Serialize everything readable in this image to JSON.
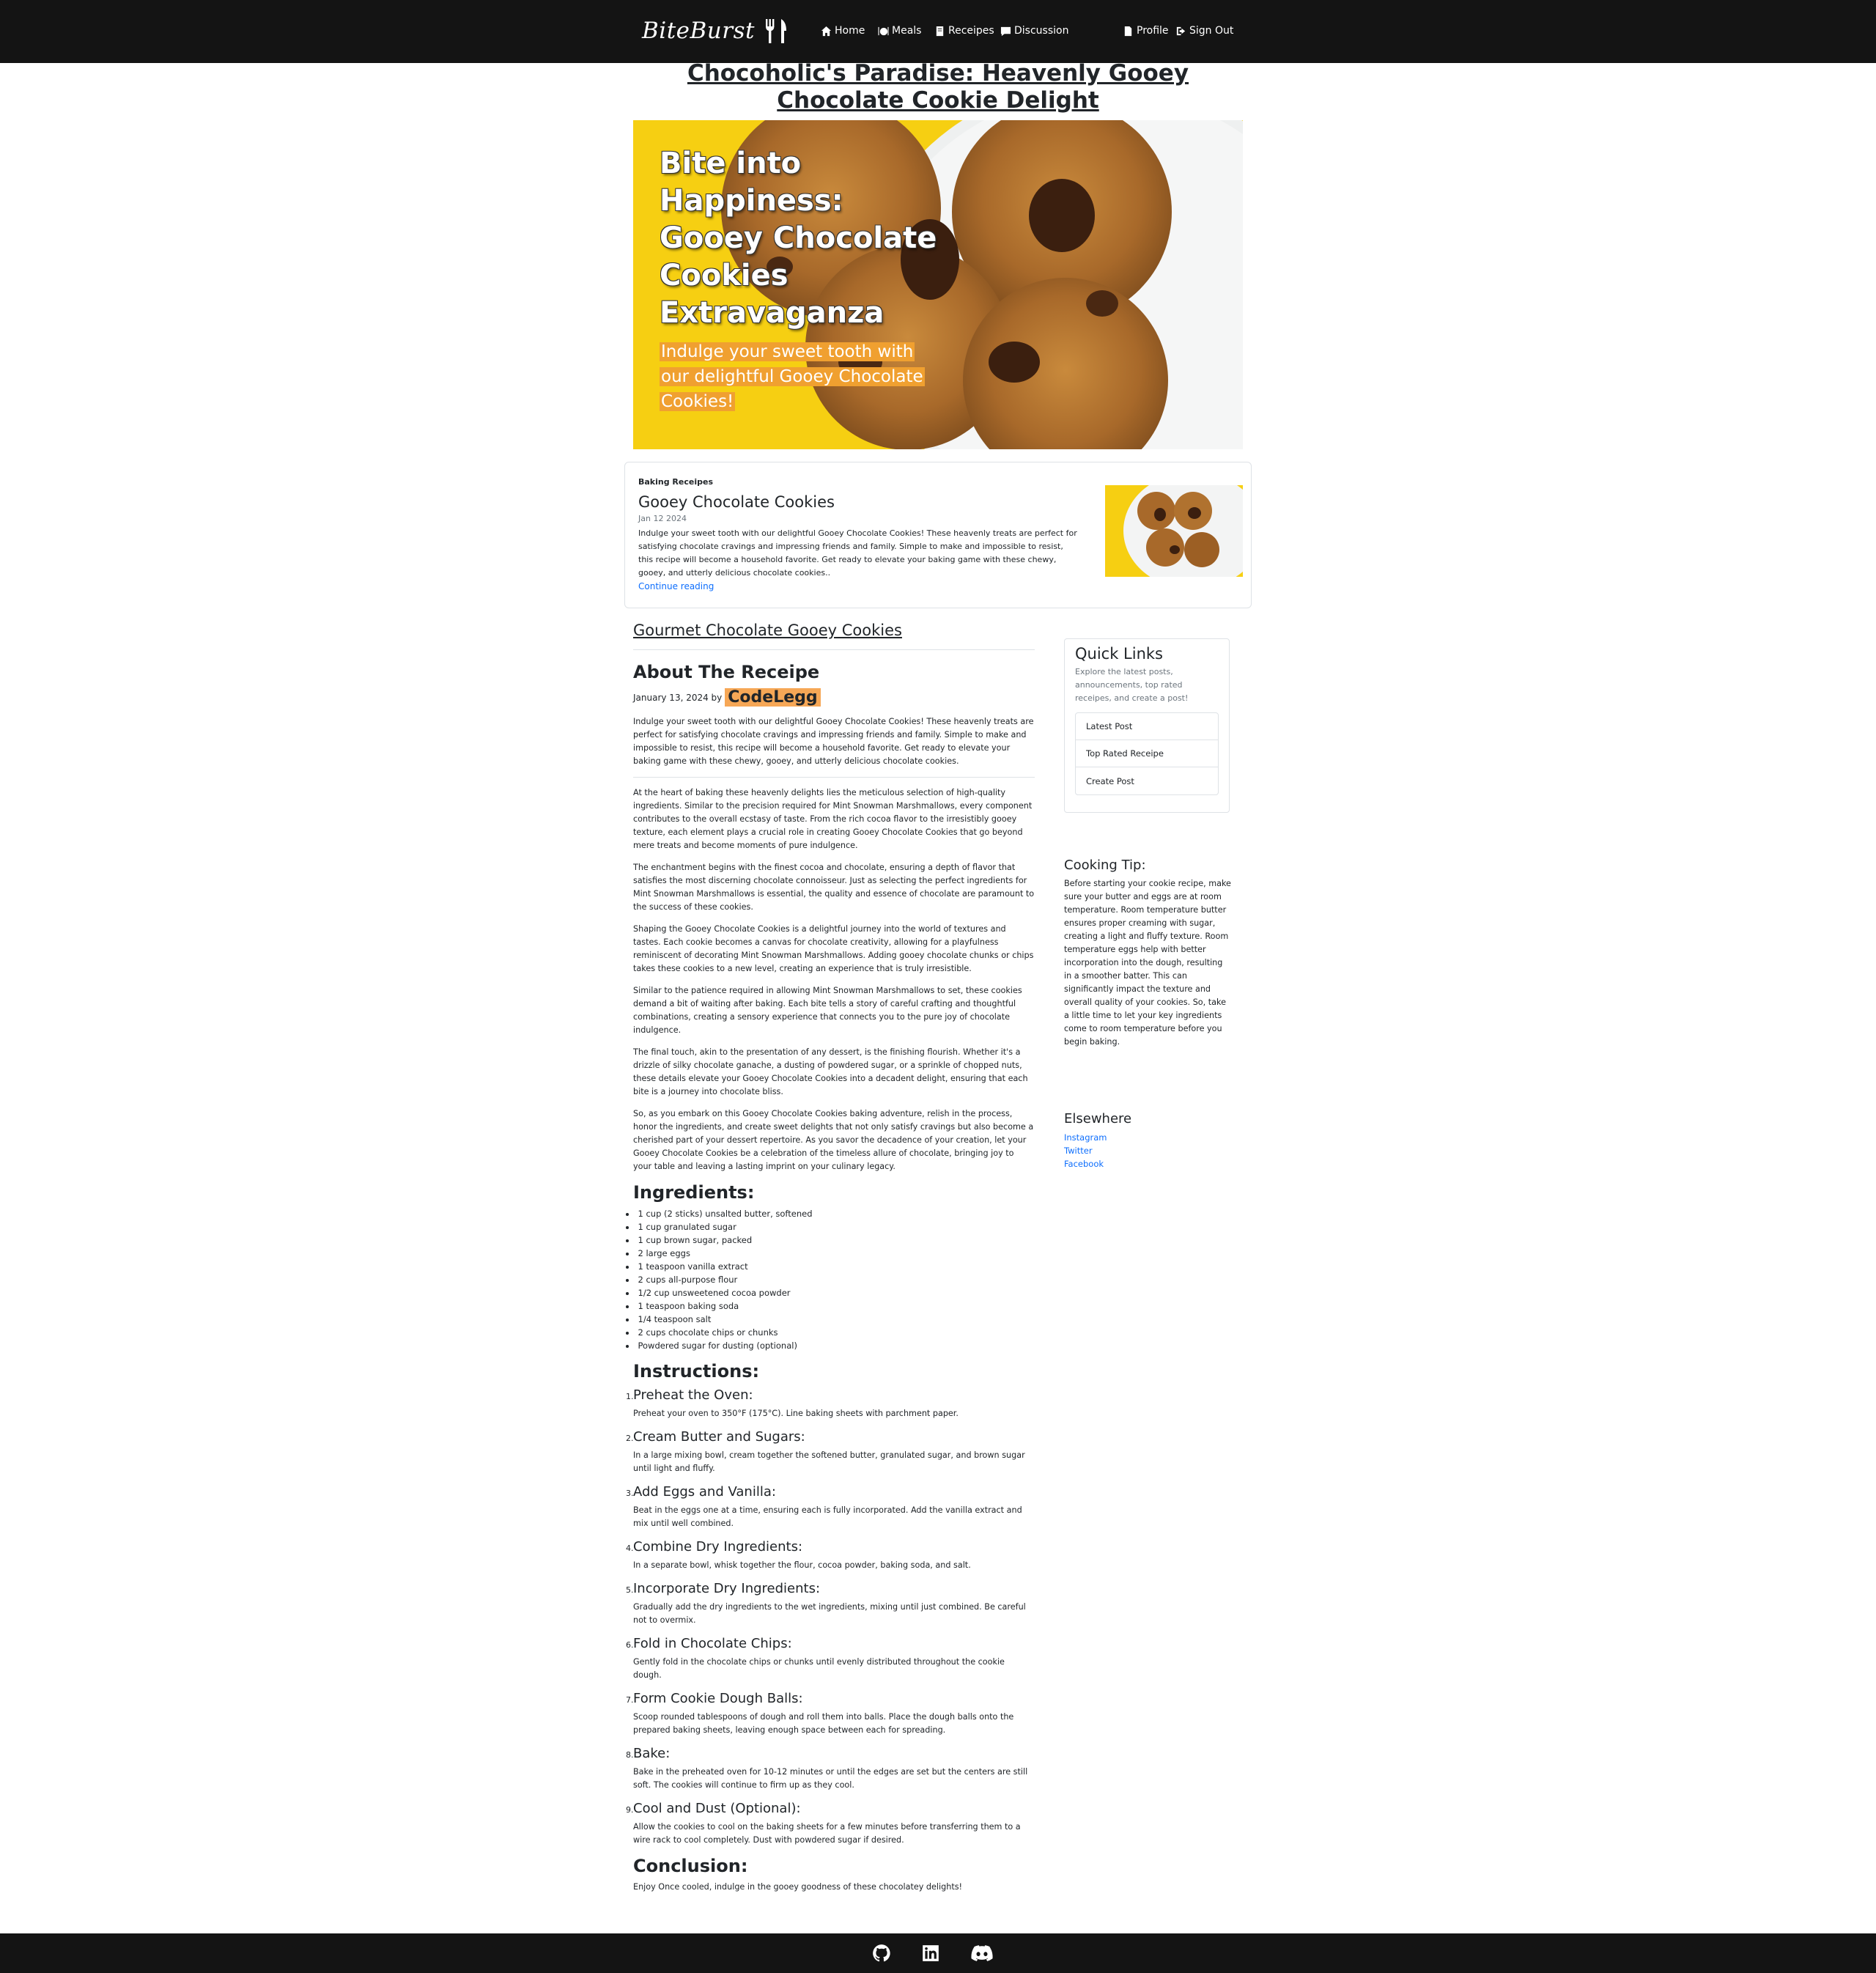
{
  "brand": {
    "name": "BiteBurst"
  },
  "nav": {
    "home": "Home",
    "meals": "Meals",
    "receipes": "Receipes",
    "discussion": "Discussion",
    "profile": "Profile",
    "signout": "Sign Out"
  },
  "page_title": "Chocoholic's Paradise: Heavenly Gooey Chocolate Cookie Delight",
  "hero": {
    "headline": "Bite into Happiness: Gooey Chocolate Cookies Extravaganza",
    "subtext": "Indulge your sweet tooth with our delightful Gooey Chocolate Cookies!"
  },
  "featured": {
    "category": "Baking Receipes",
    "title": "Gooey Chocolate Cookies",
    "date": "Jan 12 2024",
    "body": "Indulge your sweet tooth with our delightful Gooey Chocolate Cookies! These heavenly treats are perfect for satisfying chocolate cravings and impressing friends and family. Simple to make and impossible to resist, this recipe will become a household favorite. Get ready to elevate your baking game with these chewy, gooey, and utterly delicious chocolate cookies..",
    "link": "Continue reading"
  },
  "article": {
    "section_title": "Gourmet Chocolate Gooey Cookies",
    "about_title": "About The Receipe",
    "byline_date": "January 13, 2024 by",
    "author": "CodeLegg",
    "intro": "Indulge your sweet tooth with our delightful Gooey Chocolate Cookies! These heavenly treats are perfect for satisfying chocolate cravings and impressing friends and family. Simple to make and impossible to resist, this recipe will become a household favorite. Get ready to elevate your baking game with these chewy, gooey, and utterly delicious chocolate cookies.",
    "paragraphs": [
      "At the heart of baking these heavenly delights lies the meticulous selection of high-quality ingredients. Similar to the precision required for Mint Snowman Marshmallows, every component contributes to the overall ecstasy of taste. From the rich cocoa flavor to the irresistibly gooey texture, each element plays a crucial role in creating Gooey Chocolate Cookies that go beyond mere treats and become moments of pure indulgence.",
      "The enchantment begins with the finest cocoa and chocolate, ensuring a depth of flavor that satisfies the most discerning chocolate connoisseur. Just as selecting the perfect ingredients for Mint Snowman Marshmallows is essential, the quality and essence of chocolate are paramount to the success of these cookies.",
      "Shaping the Gooey Chocolate Cookies is a delightful journey into the world of textures and tastes. Each cookie becomes a canvas for chocolate creativity, allowing for a playfulness reminiscent of decorating Mint Snowman Marshmallows. Adding gooey chocolate chunks or chips takes these cookies to a new level, creating an experience that is truly irresistible.",
      "Similar to the patience required in allowing Mint Snowman Marshmallows to set, these cookies demand a bit of waiting after baking. Each bite tells a story of careful crafting and thoughtful combinations, creating a sensory experience that connects you to the pure joy of chocolate indulgence.",
      "The final touch, akin to the presentation of any dessert, is the finishing flourish. Whether it's a drizzle of silky chocolate ganache, a dusting of powdered sugar, or a sprinkle of chopped nuts, these details elevate your Gooey Chocolate Cookies into a decadent delight, ensuring that each bite is a journey into chocolate bliss.",
      "So, as you embark on this Gooey Chocolate Cookies baking adventure, relish in the process, honor the ingredients, and create sweet delights that not only satisfy cravings but also become a cherished part of your dessert repertoire. As you savor the decadence of your creation, let your Gooey Chocolate Cookies be a celebration of the timeless allure of chocolate, bringing joy to your table and leaving a lasting imprint on your culinary legacy."
    ],
    "ingredients_title": "Ingredients:",
    "ingredients": [
      "1 cup (2 sticks) unsalted butter, softened",
      "1 cup granulated sugar",
      "1 cup brown sugar, packed",
      "2 large eggs",
      "1 teaspoon vanilla extract",
      "2 cups all-purpose flour",
      "1/2 cup unsweetened cocoa powder",
      "1 teaspoon baking soda",
      "1/4 teaspoon salt",
      "2 cups chocolate chips or chunks",
      "Powdered sugar for dusting (optional)"
    ],
    "instructions_title": "Instructions:",
    "steps": [
      {
        "num": "1.",
        "title": "Preheat the Oven:",
        "desc": "Preheat your oven to 350°F (175°C). Line baking sheets with parchment paper."
      },
      {
        "num": "2.",
        "title": "Cream Butter and Sugars:",
        "desc": "In a large mixing bowl, cream together the softened butter, granulated sugar, and brown sugar until light and fluffy."
      },
      {
        "num": "3.",
        "title": "Add Eggs and Vanilla:",
        "desc": "Beat in the eggs one at a time, ensuring each is fully incorporated. Add the vanilla extract and mix until well combined."
      },
      {
        "num": "4.",
        "title": "Combine Dry Ingredients:",
        "desc": "In a separate bowl, whisk together the flour, cocoa powder, baking soda, and salt."
      },
      {
        "num": "5.",
        "title": "Incorporate Dry Ingredients:",
        "desc": "Gradually add the dry ingredients to the wet ingredients, mixing until just combined. Be careful not to overmix."
      },
      {
        "num": "6.",
        "title": "Fold in Chocolate Chips:",
        "desc": "Gently fold in the chocolate chips or chunks until evenly distributed throughout the cookie dough."
      },
      {
        "num": "7.",
        "title": "Form Cookie Dough Balls:",
        "desc": "Scoop rounded tablespoons of dough and roll them into balls. Place the dough balls onto the prepared baking sheets, leaving enough space between each for spreading."
      },
      {
        "num": "8.",
        "title": "Bake:",
        "desc": "Bake in the preheated oven for 10-12 minutes or until the edges are set but the centers are still soft. The cookies will continue to firm up as they cool."
      },
      {
        "num": "9.",
        "title": "Cool and Dust (Optional):",
        "desc": "Allow the cookies to cool on the baking sheets for a few minutes before transferring them to a wire rack to cool completely. Dust with powdered sugar if desired."
      }
    ],
    "conclusion_title": "Conclusion:",
    "conclusion": "Enjoy Once cooled, indulge in the gooey goodness of these chocolatey delights!"
  },
  "sidebar": {
    "quick_links": {
      "title": "Quick Links",
      "desc": "Explore the latest posts, announcements, top rated receipes, and create a post!",
      "items": [
        "Latest Post",
        "Top Rated Receipe",
        "Create Post"
      ]
    },
    "tip": {
      "title": "Cooking Tip:",
      "body": "Before starting your cookie recipe, make sure your butter and eggs are at room temperature. Room temperature butter ensures proper creaming with sugar, creating a light and fluffy texture. Room temperature eggs help with better incorporation into the dough, resulting in a smoother batter. This can significantly impact the texture and overall quality of your cookies. So, take a little time to let your key ingredients come to room temperature before you begin baking."
    },
    "elsewhere": {
      "title": "Elsewhere",
      "links": [
        "Instagram",
        "Twitter",
        "Facebook"
      ]
    }
  },
  "footer": {
    "icons": [
      "github-icon",
      "linkedin-icon",
      "discord-icon"
    ]
  },
  "colors": {
    "navbar": "#141414",
    "accent": "#f6a756",
    "link": "#0d6efd",
    "hero_yellow": "#f6cf12"
  }
}
